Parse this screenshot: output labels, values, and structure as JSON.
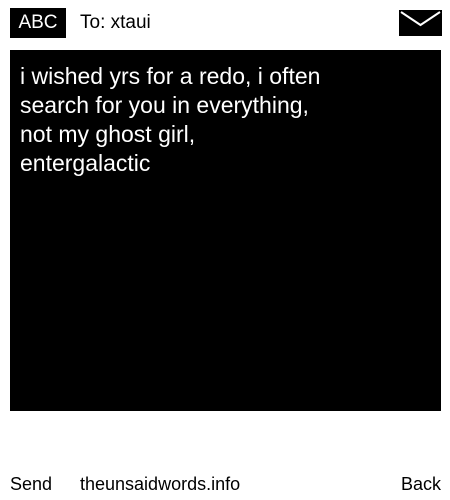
{
  "header": {
    "badge_label": "ABC",
    "recipient_label": "To: xtaui",
    "icon": "envelope-icon"
  },
  "message": {
    "text": "i wished yrs for a redo, i often\nsearch for you in everything,\nnot my ghost girl,\nentergalactic"
  },
  "footer": {
    "send_label": "Send",
    "site_label": "theunsaidwords.info",
    "back_label": "Back"
  },
  "colors": {
    "background": "#ffffff",
    "message_background": "#000000",
    "message_text": "#ffffff",
    "text": "#000000"
  }
}
